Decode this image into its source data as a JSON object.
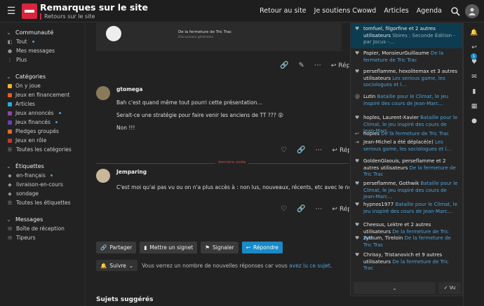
{
  "header": {
    "site_title": "Remarques sur le site",
    "site_sub": "Retours sur le site",
    "nav": [
      "Retour au site",
      "Je soutiens Cwowd",
      "Articles",
      "Agenda"
    ]
  },
  "sidebar": {
    "communaute": {
      "title": "Communauté",
      "items": [
        {
          "label": "Tout",
          "icon": "layers-icon"
        },
        {
          "label": "Mes messages",
          "icon": "user-icon"
        },
        {
          "label": "Plus",
          "icon": "more-icon"
        }
      ]
    },
    "categories": {
      "title": "Catégories",
      "items": [
        {
          "label": "On y joue",
          "color": "#f0b429"
        },
        {
          "label": "Jeux en financement",
          "color": "#e85d1a"
        },
        {
          "label": "Articles",
          "color": "#2eaad8"
        },
        {
          "label": "Jeux annoncés",
          "color": "#8e44ad"
        },
        {
          "label": "Jeux financés",
          "color": "#6c3fb5"
        },
        {
          "label": "Pledges groupés",
          "color": "#e06a2a"
        },
        {
          "label": "Jeux en rôle",
          "color": "#c0392b"
        },
        {
          "label": "Toutes les catégories",
          "color": "#888888"
        }
      ]
    },
    "etiquettes": {
      "title": "Étiquettes",
      "items": [
        "en-français",
        "livraison-en-cours",
        "sondage",
        "Toutes les étiquettes"
      ]
    },
    "messages": {
      "title": "Messages",
      "items": [
        "Boîte de réception",
        "Tipeurs"
      ]
    }
  },
  "main": {
    "embed": {
      "title": "De la fermeture de Tric Trac",
      "meta": "Discussions générales"
    },
    "reply_label": "Répo",
    "post1": {
      "user": "gtomega",
      "line1": "Bah c'est quand même tout pourri cette présentation…",
      "line2": "Serait-ce une stratégie pour faire venir les anciens de TT ??? 😲",
      "line3": "Non !!!"
    },
    "divider": "dernière visite",
    "post2": {
      "user": "Jemparing",
      "line1": "C'est moi qu'ai pas vu ou on n'a plus accès à : non lus, nouveaux, récents, etc avec le nouveau menu"
    },
    "buttons": {
      "share": "Partager",
      "bookmark": "Mettre un signet",
      "flag": "Signaler",
      "reply": "Répondre"
    },
    "notifications": {
      "follow": "Suivre",
      "text": "Vous verrez un nombre de nouvelles réponses car vous",
      "link": "avez lu ce sujet",
      "suffix": "."
    },
    "suggested": "Sujets suggérés"
  },
  "panel": {
    "items": [
      {
        "who": "tomfuel, filgorfine et 2 autres utilisateurs",
        "topic": "Sbires : Seconde Édition - par Jocus -…",
        "icon": "heart-icon",
        "active": true
      },
      {
        "who": "Papier, MonsieurGuillaume",
        "topic": "De la fermeture de Tric Trac",
        "icon": "heart-icon"
      },
      {
        "who": "perseflamme, hexolitemax et 3 autres utilisateurs",
        "topic": "Les serious game, les sociologues et l…",
        "icon": "heart-icon"
      },
      {
        "who": "Lutin",
        "topic": "Bataille pour le Climat, le jeu inspiré des cours de Jean-Marc…",
        "icon": "at-icon"
      },
      {
        "who": "hoples, Laurent-Xavier",
        "topic": "Bataille pour le Climat, le jeu inspiré des cours de Jean-Marc…",
        "icon": "heart-icon"
      },
      {
        "who": "hoples",
        "topic": "De la fermeture de Tric Trac",
        "icon": "reply-icon"
      },
      {
        "who": "Jean-Michel a été déplacé(e)",
        "topic": "Les serious game, les sociologues et l…",
        "icon": "move-icon"
      },
      {
        "who": "GoldenGlaouis, perseflamme et 2 autres utilisateurs",
        "topic": "De la fermeture de Tric Trac",
        "icon": "heart-icon"
      },
      {
        "who": "perseflamme, Gothwik",
        "topic": "Bataille pour le Climat, le jeu inspiré des cours de Jean-Marc…",
        "icon": "heart-icon"
      },
      {
        "who": "hypnos1977",
        "topic": "Bataille pour le Climat, le jeu inspiré des cours de Jean-Marc…",
        "icon": "heart-icon"
      },
      {
        "who": "Cheesus, Lektre et 2 autres utilisateurs",
        "topic": "De la fermeture de Tric Trac",
        "icon": "heart-icon"
      },
      {
        "who": "zythum, Tireloin",
        "topic": "De la fermeture de Tric Trac",
        "icon": "heart-icon"
      },
      {
        "who": "Chrissy, Tristanovich et 9 autres utilisateurs",
        "topic": "De la fermeture de Tric Trac",
        "icon": "heart-icon"
      }
    ],
    "more_label": "⌄",
    "vu_label": "Vu"
  },
  "rail": {
    "badge": "1"
  }
}
